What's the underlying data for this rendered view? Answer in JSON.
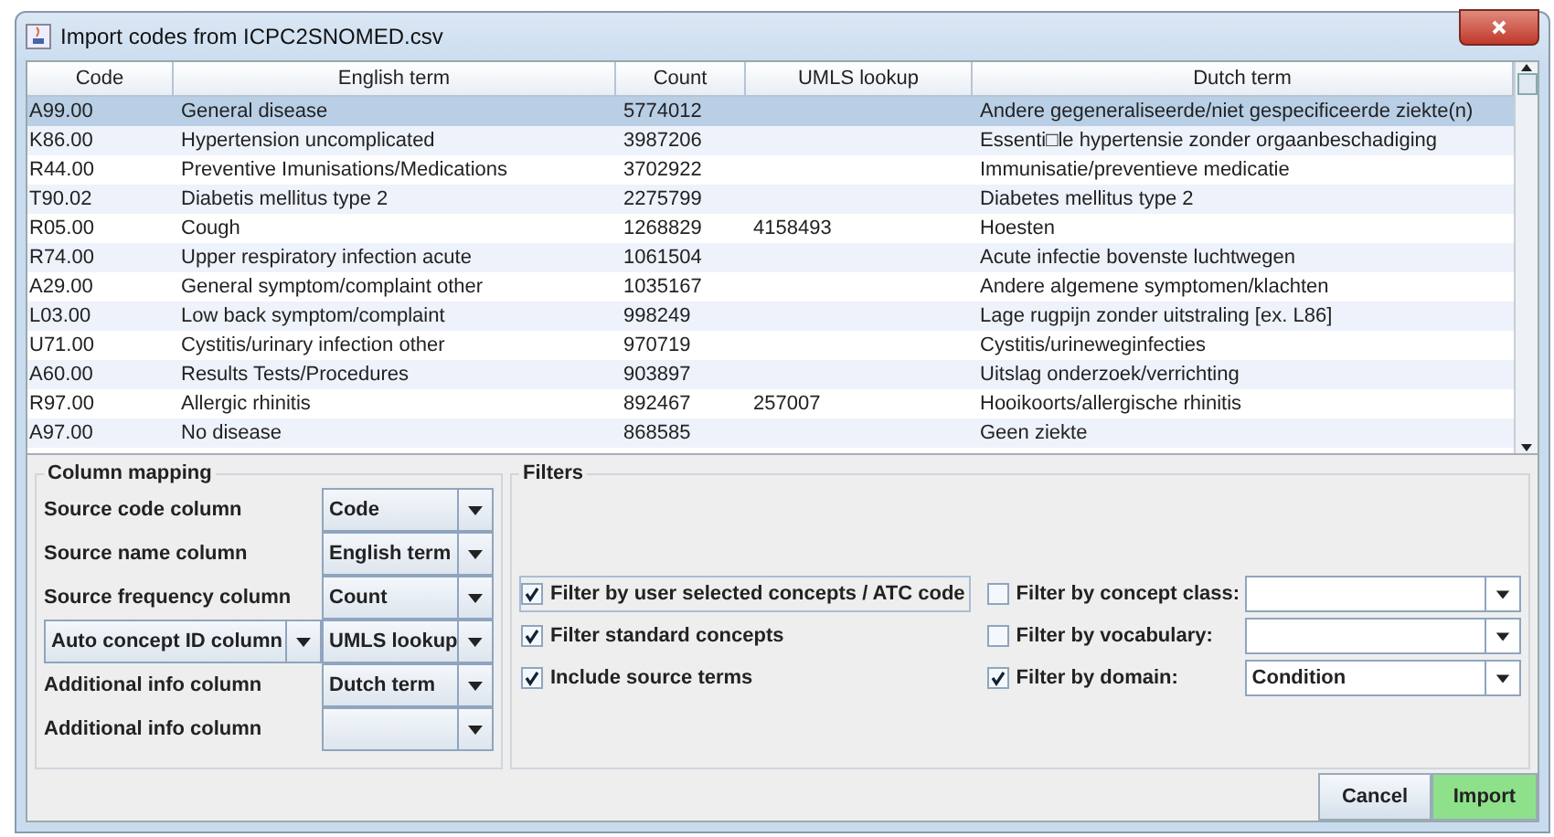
{
  "window": {
    "title": "Import codes from ICPC2SNOMED.csv"
  },
  "table": {
    "columns": [
      "Code",
      "English term",
      "Count",
      "UMLS lookup",
      "Dutch term"
    ],
    "rows": [
      {
        "cells": [
          "A99.00",
          "General disease",
          "5774012",
          "",
          "Andere gegeneraliseerde/niet gespecificeerde ziekte(n)"
        ],
        "selected": true
      },
      {
        "cells": [
          "K86.00",
          "Hypertension uncomplicated",
          "3987206",
          "",
          "Essenti□le hypertensie zonder orgaanbeschadiging"
        ],
        "selected": false
      },
      {
        "cells": [
          "R44.00",
          "Preventive Imunisations/Medications",
          "3702922",
          "",
          "Immunisatie/preventieve medicatie"
        ],
        "selected": false
      },
      {
        "cells": [
          "T90.02",
          "Diabetis mellitus type 2",
          "2275799",
          "",
          "Diabetes mellitus type 2"
        ],
        "selected": false
      },
      {
        "cells": [
          "R05.00",
          "Cough",
          "1268829",
          "4158493",
          "Hoesten"
        ],
        "selected": false
      },
      {
        "cells": [
          "R74.00",
          "Upper respiratory infection acute",
          "1061504",
          "",
          "Acute infectie bovenste luchtwegen"
        ],
        "selected": false
      },
      {
        "cells": [
          "A29.00",
          "General symptom/complaint other",
          "1035167",
          "",
          "Andere algemene symptomen/klachten"
        ],
        "selected": false
      },
      {
        "cells": [
          "L03.00",
          "Low back symptom/complaint",
          "998249",
          "",
          "Lage rugpijn zonder uitstraling [ex. L86]"
        ],
        "selected": false
      },
      {
        "cells": [
          "U71.00",
          "Cystitis/urinary infection other",
          "970719",
          "",
          "Cystitis/urineweginfecties"
        ],
        "selected": false
      },
      {
        "cells": [
          "A60.00",
          "Results Tests/Procedures",
          "903897",
          "",
          "Uitslag onderzoek/verrichting"
        ],
        "selected": false
      },
      {
        "cells": [
          "R97.00",
          "Allergic rhinitis",
          "892467",
          "257007",
          "Hooikoorts/allergische rhinitis"
        ],
        "selected": false
      },
      {
        "cells": [
          "A97.00",
          "No disease",
          "868585",
          "",
          "Geen ziekte"
        ],
        "selected": false
      }
    ]
  },
  "column_mapping": {
    "title": "Column mapping",
    "rows": [
      {
        "kind": "label",
        "label": "Source code column",
        "value": "Code"
      },
      {
        "kind": "label",
        "label": "Source name column",
        "value": "English term"
      },
      {
        "kind": "label",
        "label": "Source frequency column",
        "value": "Count"
      },
      {
        "kind": "combo",
        "label": "Auto concept ID column",
        "value": "UMLS lookup"
      },
      {
        "kind": "label",
        "label": "Additional info column",
        "value": "Dutch term"
      },
      {
        "kind": "label",
        "label": "Additional info column"
      }
    ]
  },
  "filters": {
    "title": "Filters",
    "checks": [
      {
        "label": "Filter by user selected concepts / ATC code",
        "checked": true,
        "focused": true
      },
      {
        "label": "Filter standard concepts",
        "checked": true,
        "focused": false
      },
      {
        "label": "Include source terms",
        "checked": true,
        "focused": false
      }
    ],
    "selects": [
      {
        "label": "Filter by concept class:",
        "checked": false
      },
      {
        "label": "Filter by vocabulary:",
        "checked": false
      },
      {
        "label": "Filter by domain:",
        "checked": true,
        "value": "Condition"
      }
    ]
  },
  "buttons": [
    {
      "label": "Cancel",
      "kind": "plain"
    },
    {
      "label": "Import",
      "kind": "primary"
    }
  ]
}
